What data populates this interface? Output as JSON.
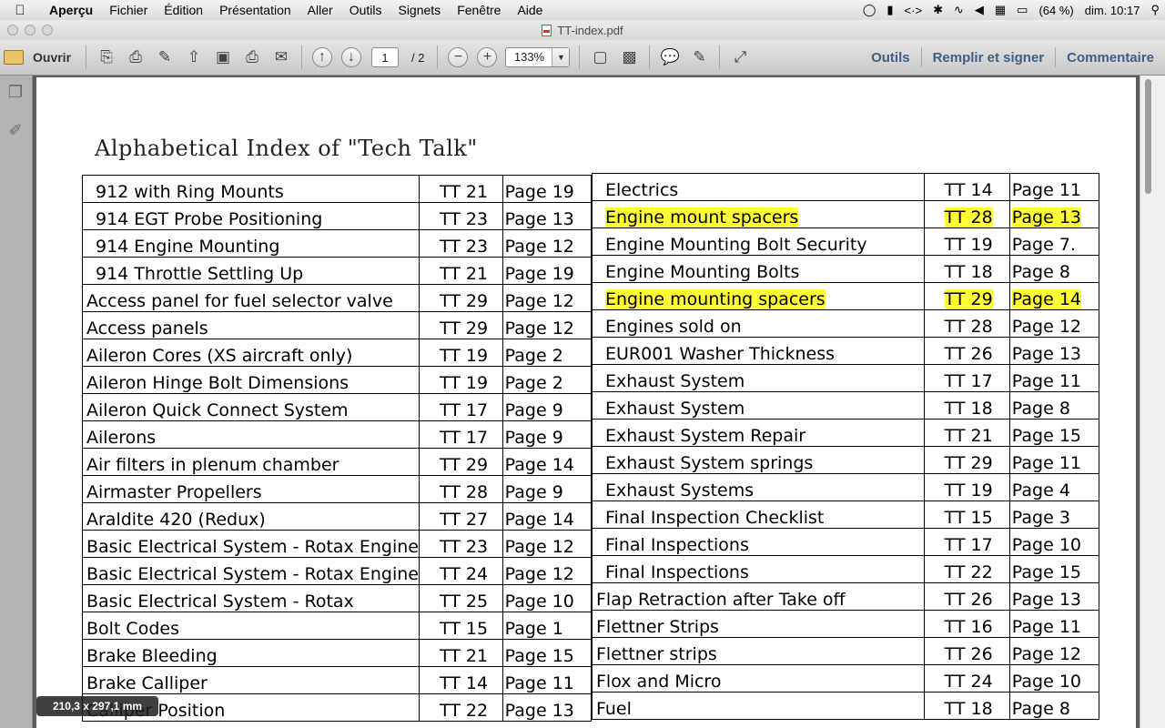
{
  "menubar": {
    "app": "Aperçu",
    "items": [
      "Fichier",
      "Édition",
      "Présentation",
      "Aller",
      "Outils",
      "Signets",
      "Fenêtre",
      "Aide"
    ],
    "battery": "(64 %)",
    "clock": "dim. 10:17"
  },
  "window": {
    "title": "TT-index.pdf"
  },
  "toolbar": {
    "open_label": "Ouvrir",
    "page_current": "1",
    "page_total": "/ 2",
    "zoom": "133%",
    "tools_label": "Outils",
    "fill_sign_label": "Remplir et signer",
    "comment_label": "Commentaire"
  },
  "document": {
    "title": "Alphabetical Index of \"Tech Talk\"",
    "left_rows": [
      {
        "topic": "912 with Ring Mounts",
        "tt": "TT 21",
        "page": "Page 19",
        "indent": true
      },
      {
        "topic": "914 EGT Probe Positioning",
        "tt": "TT 23",
        "page": "Page 13",
        "indent": true
      },
      {
        "topic": "914 Engine Mounting",
        "tt": "TT 23",
        "page": "Page 12",
        "indent": true
      },
      {
        "topic": "914 Throttle Settling Up",
        "tt": "TT 21",
        "page": "Page 19",
        "indent": true
      },
      {
        "topic": "Access panel for fuel selector valve",
        "tt": "TT 29",
        "page": "Page 12"
      },
      {
        "topic": "Access panels",
        "tt": "TT 29",
        "page": "Page 12"
      },
      {
        "topic": "Aileron Cores (XS aircraft only)",
        "tt": "TT 19",
        "page": "Page 2"
      },
      {
        "topic": "Aileron Hinge Bolt Dimensions",
        "tt": "TT 19",
        "page": "Page 2"
      },
      {
        "topic": "Aileron Quick Connect System",
        "tt": "TT 17",
        "page": "Page 9"
      },
      {
        "topic": "Ailerons",
        "tt": "TT 17",
        "page": "Page 9"
      },
      {
        "topic": "Air filters in plenum chamber",
        "tt": "TT 29",
        "page": "Page 14"
      },
      {
        "topic": "Airmaster Propellers",
        "tt": "TT 28",
        "page": "Page 9"
      },
      {
        "topic": "Araldite 420 (Redux)",
        "tt": "TT 27",
        "page": "Page 14"
      },
      {
        "topic": "Basic Electrical System - Rotax Engine",
        "tt": "TT 23",
        "page": "Page 12"
      },
      {
        "topic": "Basic Electrical System - Rotax Engine",
        "tt": "TT 24",
        "page": "Page 12"
      },
      {
        "topic": "Basic Electrical System - Rotax",
        "tt": "TT 25",
        "page": "Page 10"
      },
      {
        "topic": "Bolt Codes",
        "tt": "TT 15",
        "page": "Page 1"
      },
      {
        "topic": "Brake Bleeding",
        "tt": "TT 21",
        "page": "Page 15"
      },
      {
        "topic": "Brake Calliper",
        "tt": "TT 14",
        "page": "Page 11"
      },
      {
        "topic": "Calliper Position",
        "tt": "TT 22",
        "page": "Page 13"
      }
    ],
    "right_rows": [
      {
        "topic": "Electrics",
        "tt": "TT 14",
        "page": "Page 11",
        "indent": true
      },
      {
        "topic": "Engine mount spacers",
        "tt": "TT 28",
        "page": "Page 13",
        "indent": true,
        "highlight": true
      },
      {
        "topic": "Engine Mounting Bolt Security",
        "tt": "TT 19",
        "page": "Page 7.",
        "indent": true
      },
      {
        "topic": "Engine Mounting Bolts",
        "tt": "TT 18",
        "page": "Page 8",
        "indent": true
      },
      {
        "topic": "Engine mounting spacers",
        "tt": "TT 29",
        "page": "Page 14",
        "indent": true,
        "highlight": true
      },
      {
        "topic": "Engines sold on",
        "tt": "TT 28",
        "page": "Page 12",
        "indent": true
      },
      {
        "topic": "EUR001 Washer Thickness",
        "tt": "TT 26",
        "page": "Page 13",
        "indent": true
      },
      {
        "topic": "Exhaust System",
        "tt": "TT 17",
        "page": "Page 11",
        "indent": true
      },
      {
        "topic": "Exhaust System",
        "tt": "TT 18",
        "page": "Page 8",
        "indent": true
      },
      {
        "topic": "Exhaust System Repair",
        "tt": "TT 21",
        "page": "Page 15",
        "indent": true
      },
      {
        "topic": "Exhaust System springs",
        "tt": "TT 29",
        "page": "Page 11",
        "indent": true
      },
      {
        "topic": "Exhaust Systems",
        "tt": "TT 19",
        "page": "Page 4",
        "indent": true
      },
      {
        "topic": "Final Inspection Checklist",
        "tt": "TT 15",
        "page": "Page 3",
        "indent": true
      },
      {
        "topic": "Final Inspections",
        "tt": "TT 17",
        "page": "Page 10",
        "indent": true
      },
      {
        "topic": "Final Inspections",
        "tt": "TT 22",
        "page": "Page 15",
        "indent": true
      },
      {
        "topic": "Flap Retraction after Take off",
        "tt": "TT 26",
        "page": "Page 13"
      },
      {
        "topic": "Flettner Strips",
        "tt": "TT 16",
        "page": "Page 11"
      },
      {
        "topic": "Flettner strips",
        "tt": "TT 26",
        "page": "Page 12"
      },
      {
        "topic": "Flox and Micro",
        "tt": "TT 24",
        "page": "Page 10"
      },
      {
        "topic": "Fuel",
        "tt": "TT 18",
        "page": "Page 8"
      }
    ]
  },
  "size_hud": "210,3 x 297,1 mm",
  "colors": {
    "highlight": "#ffff33",
    "toolbar_link": "#3f5f86"
  }
}
